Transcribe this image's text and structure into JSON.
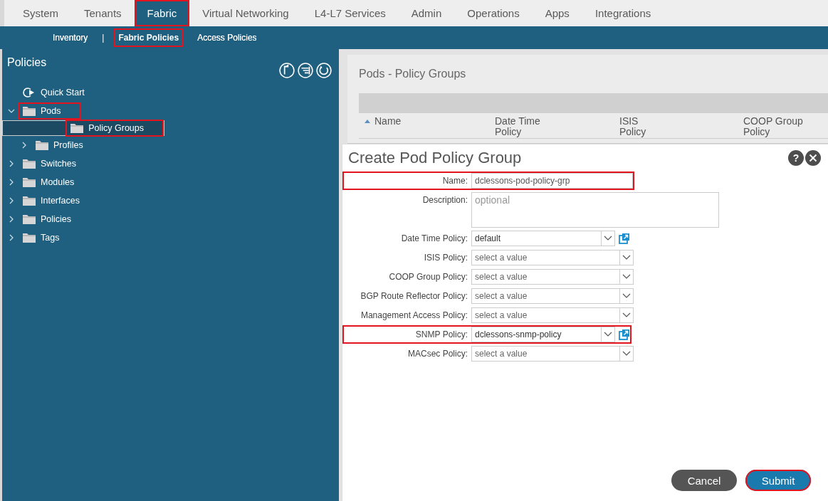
{
  "top_tabs": [
    {
      "label": "System",
      "selected": false,
      "highlighted": false
    },
    {
      "label": "Tenants",
      "selected": false,
      "highlighted": false
    },
    {
      "label": "Fabric",
      "selected": true,
      "highlighted": true
    },
    {
      "label": "Virtual Networking",
      "selected": false,
      "highlighted": false
    },
    {
      "label": "L4-L7 Services",
      "selected": false,
      "highlighted": false
    },
    {
      "label": "Admin",
      "selected": false,
      "highlighted": false
    },
    {
      "label": "Operations",
      "selected": false,
      "highlighted": false
    },
    {
      "label": "Apps",
      "selected": false,
      "highlighted": false
    },
    {
      "label": "Integrations",
      "selected": false,
      "highlighted": false
    }
  ],
  "sub_nav": [
    {
      "kind": "link",
      "label": "Inventory",
      "selected": false,
      "highlighted": false
    },
    {
      "kind": "separator",
      "label": "|"
    },
    {
      "kind": "link",
      "label": "Fabric Policies",
      "selected": true,
      "highlighted": true
    },
    {
      "kind": "link",
      "label": "Access Policies",
      "selected": false,
      "highlighted": false
    }
  ],
  "sidebar": {
    "title": "Policies",
    "tree": [
      {
        "kind": "action",
        "label": "Quick Start",
        "selected": false,
        "highlighted": false
      },
      {
        "kind": "folder",
        "label": "Pods",
        "expanded": true,
        "selected": false,
        "highlighted": true,
        "children": [
          {
            "kind": "folder",
            "label": "Policy Groups",
            "selected": true,
            "highlighted": true
          },
          {
            "kind": "folder",
            "label": "Profiles",
            "expanded": false,
            "selected": false,
            "highlighted": false
          }
        ]
      },
      {
        "kind": "folder",
        "label": "Switches",
        "expanded": false,
        "selected": false,
        "highlighted": false
      },
      {
        "kind": "folder",
        "label": "Modules",
        "expanded": false,
        "selected": false,
        "highlighted": false
      },
      {
        "kind": "folder",
        "label": "Interfaces",
        "expanded": false,
        "selected": false,
        "highlighted": false
      },
      {
        "kind": "folder",
        "label": "Policies",
        "expanded": false,
        "selected": false,
        "highlighted": false
      },
      {
        "kind": "folder",
        "label": "Tags",
        "expanded": false,
        "selected": false,
        "highlighted": false
      }
    ]
  },
  "table": {
    "title": "Pods - Policy Groups",
    "columns": [
      {
        "label": "Name",
        "sorted": true
      },
      {
        "label": "Date Time Policy",
        "sorted": false
      },
      {
        "label": "ISIS Policy",
        "sorted": false
      },
      {
        "label": "COOP Group Policy",
        "sorted": false
      }
    ]
  },
  "dialog": {
    "title": "Create Pod Policy Group",
    "help_label": "?",
    "fields": [
      {
        "kind": "text",
        "label": "Name:",
        "value": "dclessons-pod-policy-grp",
        "highlighted": true,
        "link": false
      },
      {
        "kind": "textarea",
        "label": "Description:",
        "placeholder": "optional",
        "highlighted": false,
        "link": false
      },
      {
        "kind": "select",
        "label": "Date Time Policy:",
        "value": "default",
        "highlighted": false,
        "link": true
      },
      {
        "kind": "select",
        "label": "ISIS Policy:",
        "placeholder": "select a value",
        "highlighted": false,
        "link": false
      },
      {
        "kind": "select",
        "label": "COOP Group Policy:",
        "placeholder": "select a value",
        "highlighted": false,
        "link": false
      },
      {
        "kind": "select",
        "label": "BGP Route Reflector Policy:",
        "placeholder": "select a value",
        "highlighted": false,
        "link": false
      },
      {
        "kind": "select",
        "label": "Management Access Policy:",
        "placeholder": "select a value",
        "highlighted": false,
        "link": false
      },
      {
        "kind": "select",
        "label": "SNMP Policy:",
        "value": "dclessons-snmp-policy",
        "highlighted": true,
        "link": true
      },
      {
        "kind": "select",
        "label": "MACsec Policy:",
        "placeholder": "select a value",
        "highlighted": false,
        "link": false
      }
    ],
    "buttons": [
      {
        "kind": "secondary",
        "label": "Cancel",
        "highlighted": false
      },
      {
        "kind": "primary",
        "label": "Submit",
        "highlighted": true
      }
    ]
  }
}
